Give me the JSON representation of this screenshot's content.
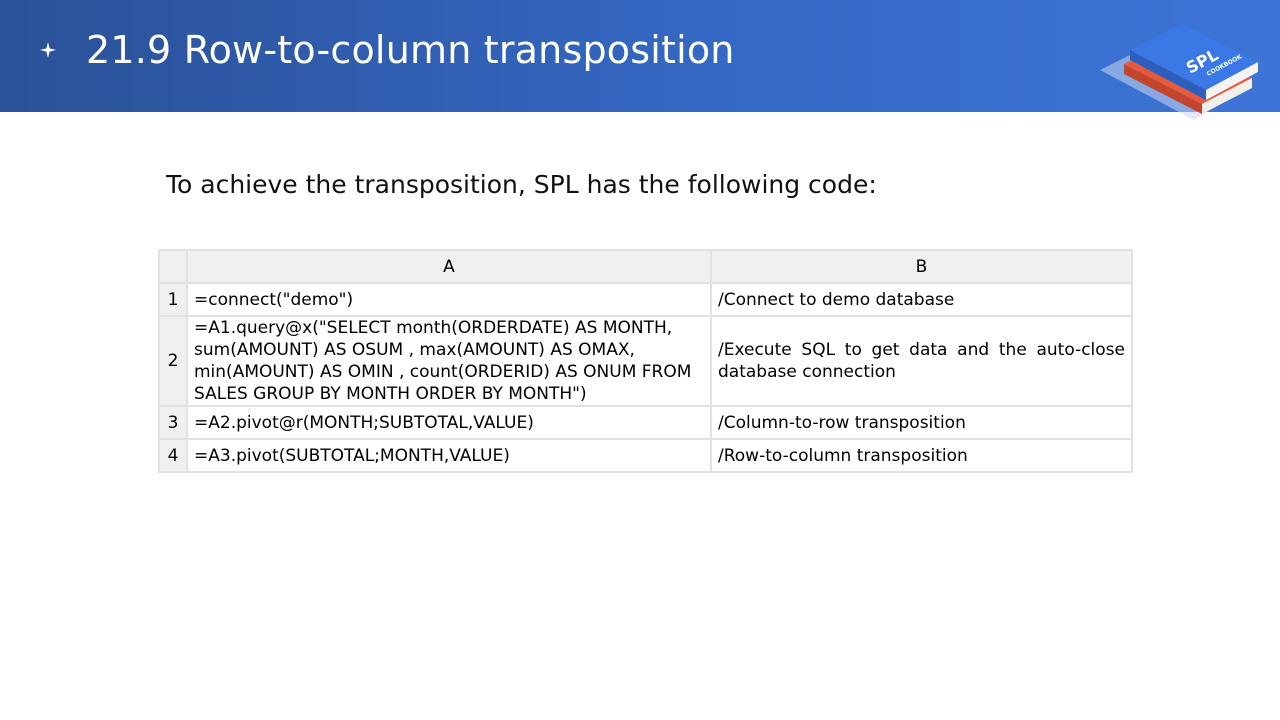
{
  "header": {
    "title": "21.9 Row-to-column transposition",
    "logo_text": "SPL",
    "logo_subtext": "COOKBOOK",
    "star_icon": "four-point-star-icon"
  },
  "intro_text": "To achieve the transposition, SPL has the following code:",
  "grid": {
    "columns": [
      "A",
      "B"
    ],
    "rows": [
      {
        "num": "1",
        "a": "=connect(\"demo\")",
        "b": "/Connect to demo database"
      },
      {
        "num": "2",
        "a": "=A1.query@x(\"SELECT month(ORDERDATE) AS MONTH, sum(AMOUNT) AS OSUM , max(AMOUNT) AS OMAX, min(AMOUNT) AS OMIN , count(ORDERID) AS ONUM FROM SALES GROUP BY MONTH ORDER BY MONTH\")",
        "b": "/Execute SQL to get data and the auto-close database connection"
      },
      {
        "num": "3",
        "a": "=A2.pivot@r(MONTH;SUBTOTAL,VALUE)",
        "b": "/Column-to-row transposition"
      },
      {
        "num": "4",
        "a": "=A3.pivot(SUBTOTAL;MONTH,VALUE)",
        "b": "/Row-to-column transposition"
      }
    ]
  },
  "colors": {
    "header_start": "#2b5197",
    "header_end": "#3d74d6",
    "grid_header_bg": "#f0f0f0",
    "grid_border": "#e1e1e1"
  }
}
